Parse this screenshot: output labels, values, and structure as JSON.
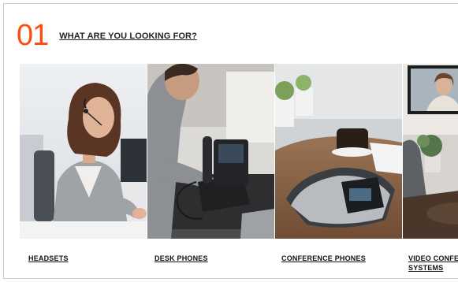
{
  "section": {
    "number": "01",
    "title": "WHAT ARE YOU LOOKING FOR?"
  },
  "cards": [
    {
      "label": "HEADSETS",
      "image": "woman-wearing-headset-photo"
    },
    {
      "label": "DESK PHONES",
      "image": "man-using-desk-phone-photo"
    },
    {
      "label": "CONFERENCE PHONES",
      "image": "conference-phone-on-table-photo"
    },
    {
      "label": "VIDEO CONFER\nSYSTEMS",
      "image": "video-conference-room-photo"
    }
  ],
  "colors": {
    "accent": "#ff4a10",
    "text": "#222222"
  }
}
